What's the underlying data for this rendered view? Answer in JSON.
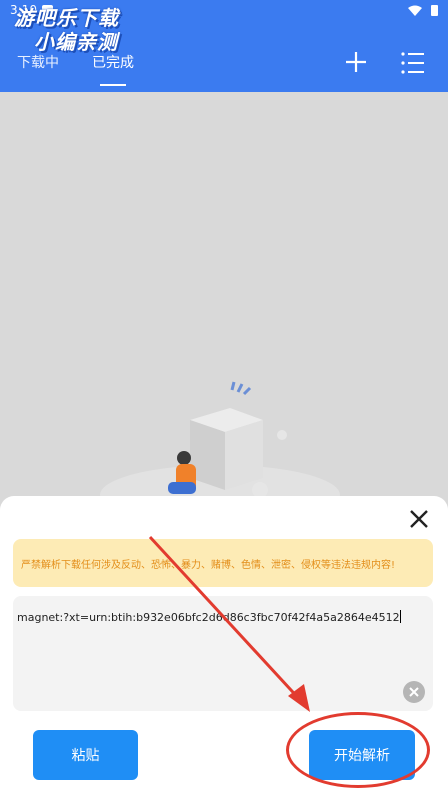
{
  "status_bar": {
    "time": "3:10"
  },
  "watermark": {
    "line1": "游吧乐下载",
    "line2": "小编亲测"
  },
  "tabs": [
    {
      "label": "下载中"
    },
    {
      "label": "已完成"
    }
  ],
  "sheet": {
    "warning_text": "严禁解析下载任何涉及反动、恐怖、暴力、赌博、色情、泄密、侵权等违法违规内容!",
    "input_value": "magnet:?xt=urn:btih:b932e06bfc2d6d86c3fbc70f42f4a5a2864e4512",
    "paste_label": "粘贴",
    "start_label": "开始解析"
  },
  "colors": {
    "primary": "#3b7bf0",
    "button": "#1f8ef5",
    "warning_bg": "#fdebb5",
    "warning_text": "#e38e1a",
    "annotation": "#e23b2f"
  }
}
